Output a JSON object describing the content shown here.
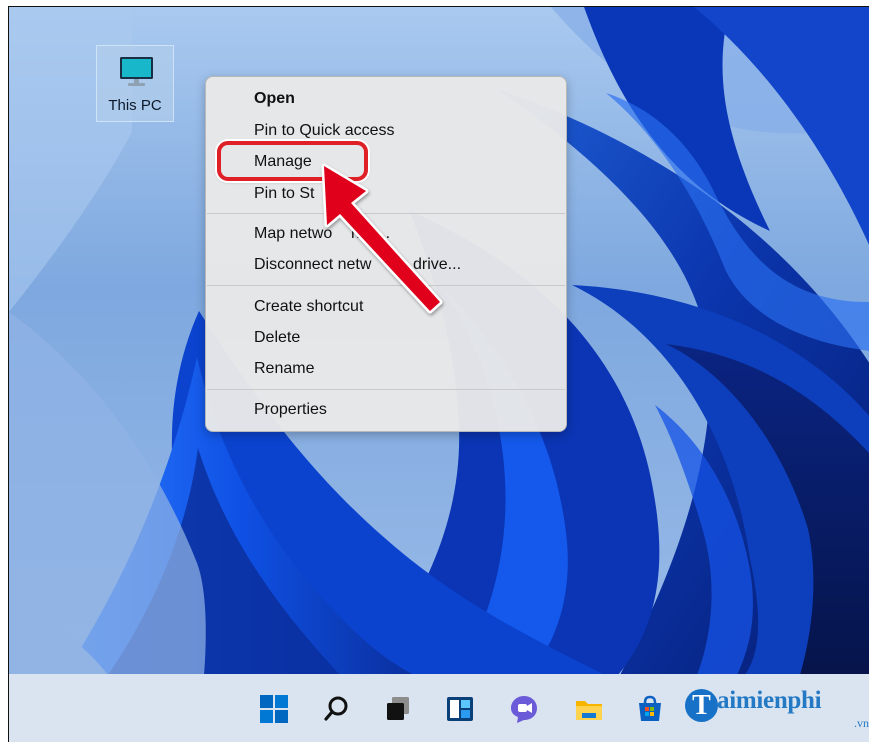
{
  "desktop": {
    "this_pc_label": "This PC"
  },
  "context_menu": {
    "items": [
      {
        "label": "Open",
        "bold": true
      },
      {
        "label": "Pin to Quick access"
      },
      {
        "label": "Manage"
      },
      {
        "label": "Pin to St"
      },
      {
        "label": "Map netwo"
      },
      {
        "label": "rive..."
      },
      {
        "label": "Disconnect netw"
      },
      {
        "label": "drive..."
      },
      {
        "label": "Create shortcut"
      },
      {
        "label": "Delete"
      },
      {
        "label": "Rename"
      },
      {
        "label": "Properties"
      }
    ]
  },
  "taskbar": {
    "icons": [
      "windows-start-icon",
      "search-icon",
      "task-view-icon",
      "widgets-icon",
      "chat-icon",
      "file-explorer-icon",
      "microsoft-store-icon"
    ]
  },
  "watermark": {
    "badge": "T",
    "text": "aimienphi",
    "suffix": ".vn"
  },
  "colors": {
    "accent_red": "#e02027",
    "taskbar_blue": "#0067c0",
    "watermark_blue": "#2479c5"
  }
}
